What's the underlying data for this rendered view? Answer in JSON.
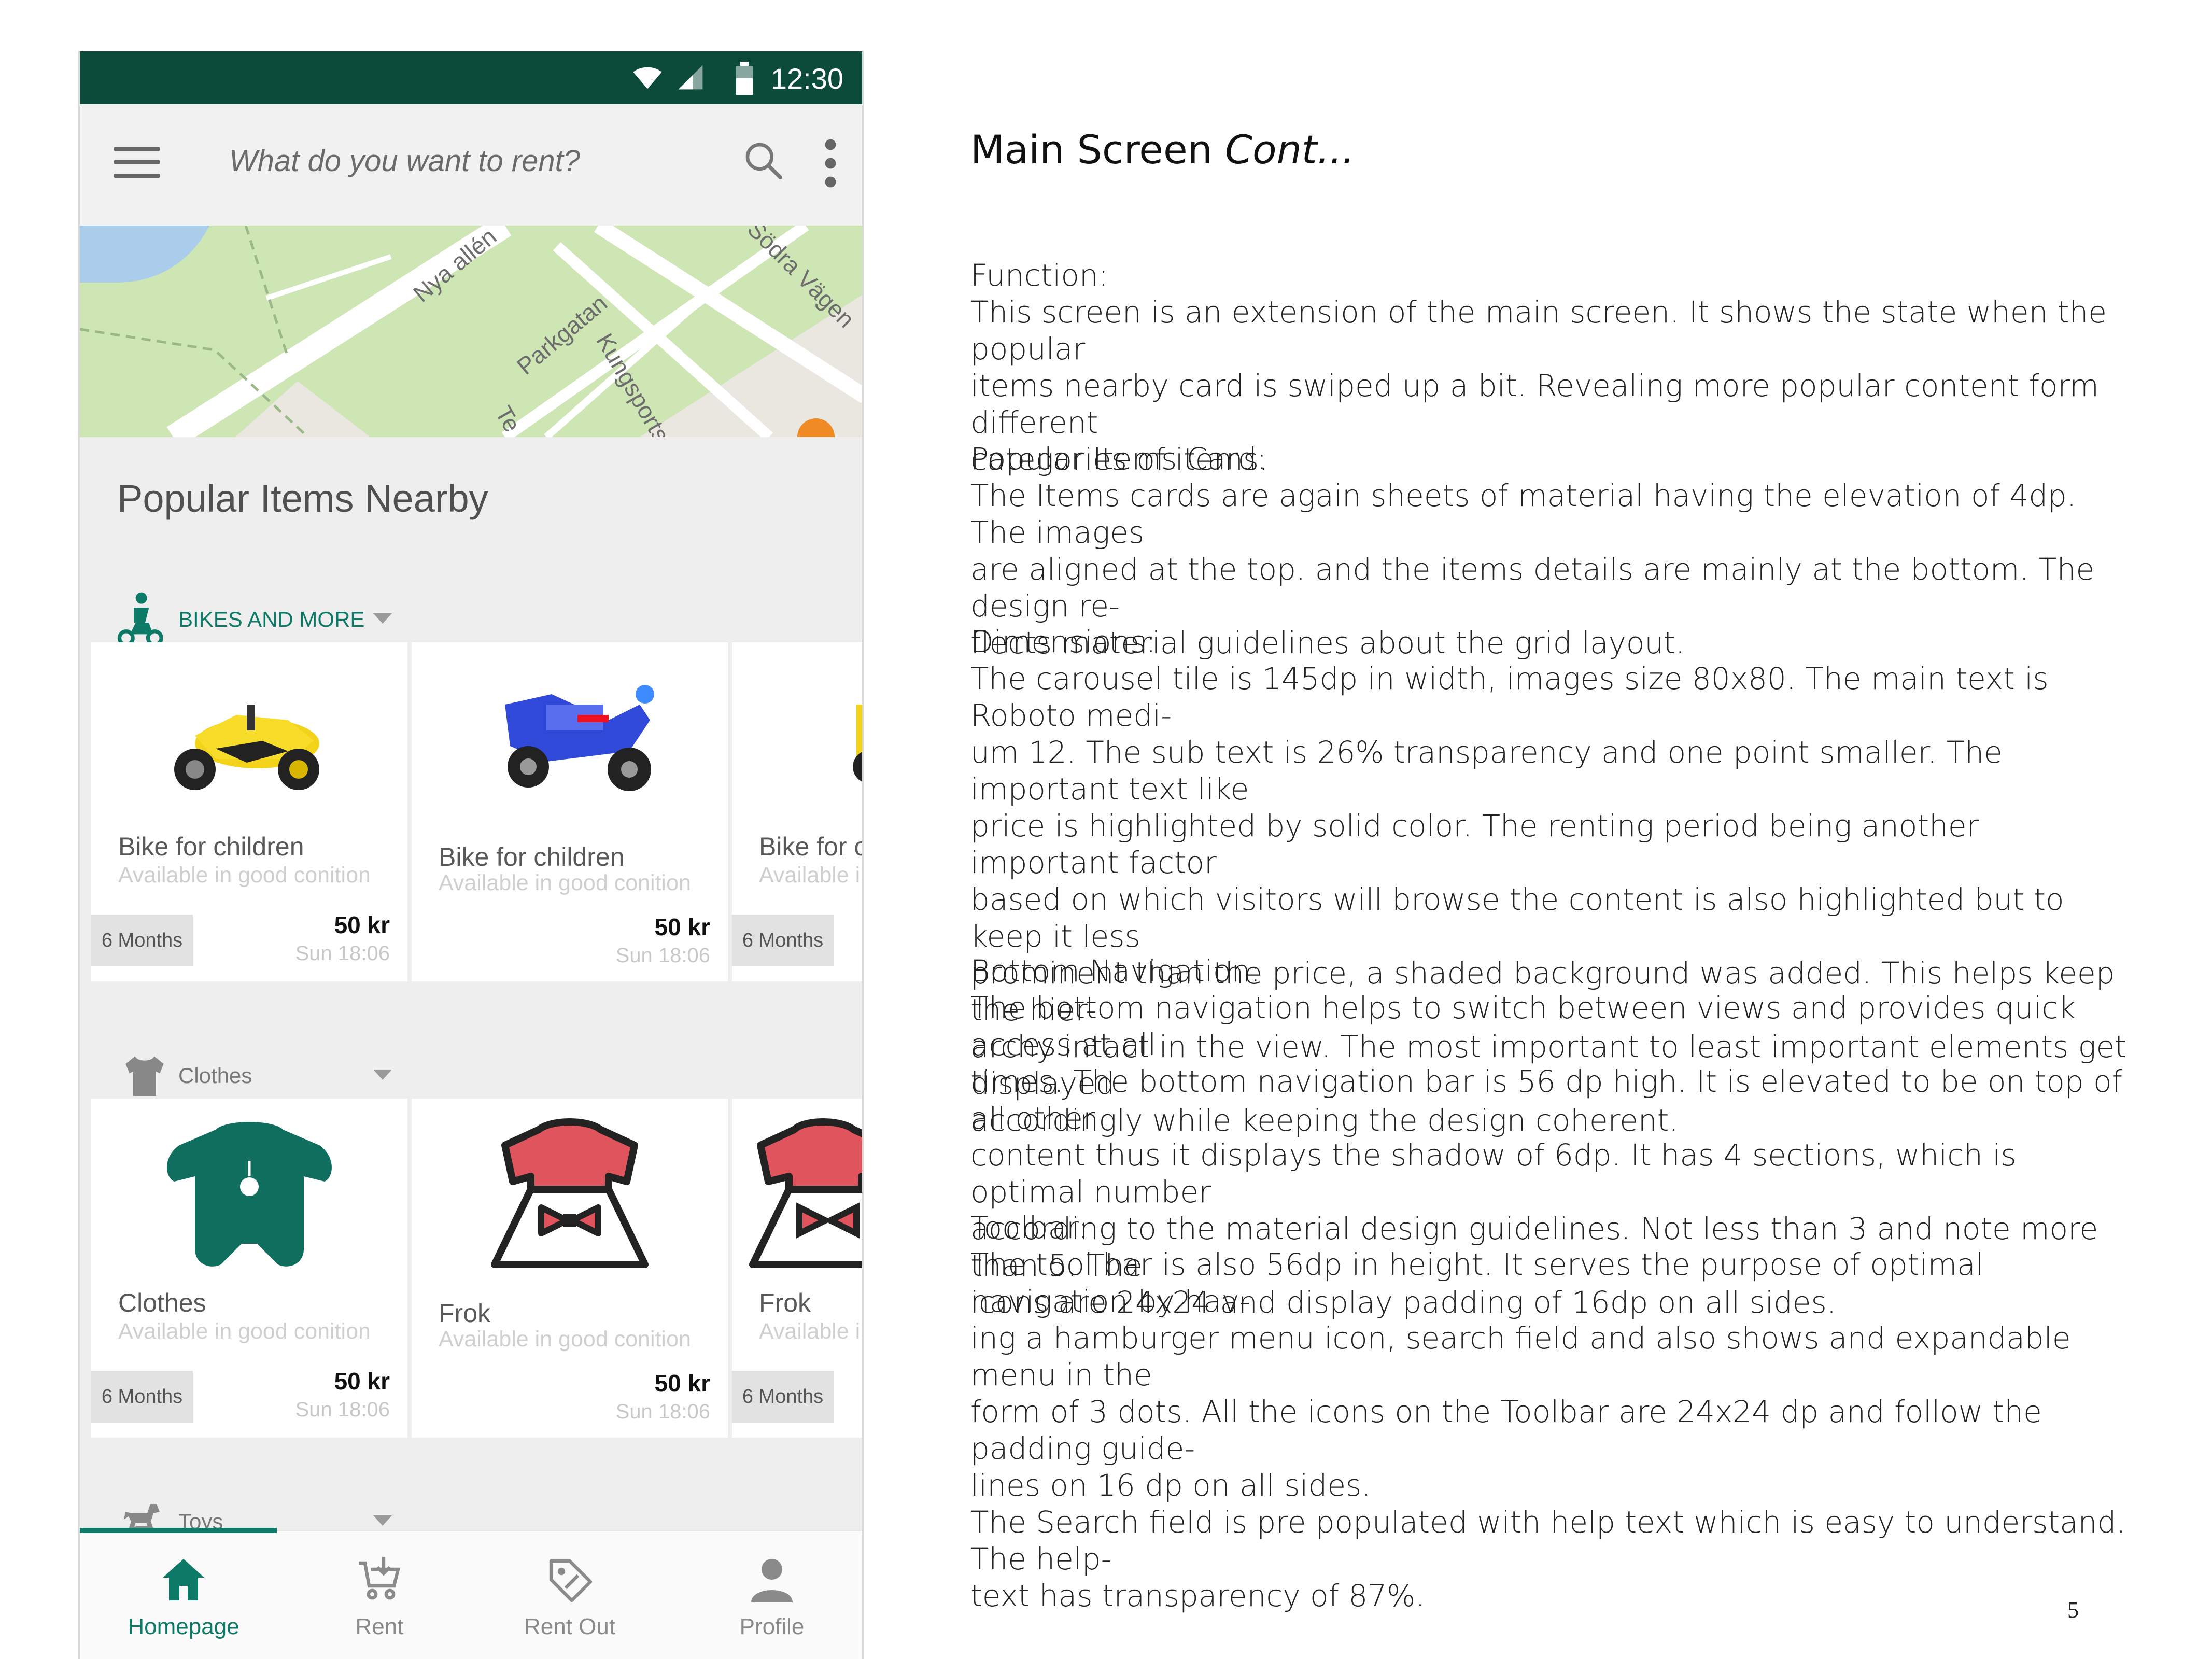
{
  "status_bar": {
    "time": "12:30"
  },
  "toolbar": {
    "search_placeholder": "What do you want to rent?"
  },
  "map": {
    "street_labels": [
      "Nya allén",
      "Parkgatan",
      "Kungsportsavenyn",
      "Södra Vägen",
      "Te"
    ]
  },
  "popular": {
    "title": "Popular Items Nearby",
    "categories": [
      {
        "label": "BIKES AND MORE",
        "icon": "bike-icon",
        "items": [
          {
            "title": "Bike for children",
            "subtitle": "Available in good conition",
            "period": "6 Months",
            "price": "50 kr",
            "date": "Sun 18:06",
            "image": "yellow-toy-bike"
          },
          {
            "title": "Bike for children",
            "subtitle": "Available in good conition",
            "period": "",
            "price": "50 kr",
            "date": "Sun 18:06",
            "image": "blue-toy-motorbike"
          },
          {
            "title": "Bike for c",
            "subtitle": "Available i",
            "period": "6 Months",
            "price": "",
            "date": "",
            "image": "yellow-toy-bike"
          }
        ]
      },
      {
        "label": "Clothes",
        "icon": "tshirt-icon",
        "items": [
          {
            "title": "Clothes",
            "subtitle": "Available in good conition",
            "period": "6 Months",
            "price": "50 kr",
            "date": "Sun 18:06",
            "image": "green-baby-romper"
          },
          {
            "title": "Frok",
            "subtitle": "Available in good conition",
            "period": "",
            "price": "50 kr",
            "date": "Sun 18:06",
            "image": "red-dress"
          },
          {
            "title": "Frok",
            "subtitle": "Available i",
            "period": "6 Months",
            "price": "",
            "date": "",
            "image": "red-dress"
          }
        ]
      },
      {
        "label": "Toys",
        "icon": "rocking-horse-icon"
      }
    ]
  },
  "bottom_nav": {
    "items": [
      {
        "label": "Homepage",
        "icon": "home-icon",
        "active": true
      },
      {
        "label": "Rent",
        "icon": "cart-icon",
        "active": false
      },
      {
        "label": "Rent Out",
        "icon": "tag-icon",
        "active": false
      },
      {
        "label": "Profile",
        "icon": "person-icon",
        "active": false
      }
    ]
  },
  "colors": {
    "accent": "#0c7a66",
    "status_bar": "#0c4b39",
    "card_bg": "#ffffff",
    "screen_bg": "#eeeeee"
  },
  "description": {
    "title_main": "Main Screen",
    "title_italic": "Cont...",
    "sections": [
      {
        "heading": "Function:",
        "lines": [
          "This screen is an extension of the main screen. It shows the state when the popular",
          "items nearby card is swiped up a bit. Revealing more popular content form different",
          "categories of items."
        ]
      },
      {
        "heading": "Popular Items Card:",
        "lines": [
          "The Items cards are again sheets of material having the elevation of 4dp. The images",
          "are aligned at the top. and the items details are mainly at the bottom. The design re-",
          "flects material guidelines about the grid layout."
        ]
      },
      {
        "heading": "Dimensions:",
        "lines": [
          "The carousel tile is 145dp in width, images size 80x80. The main text is Roboto medi-",
          "um 12. The sub text is 26% transparency and one point smaller. The important text like",
          "price is highlighted by solid color. The renting period being another important factor",
          "based on which visitors will browse the content is also highlighted but to keep it less",
          "prominent than the price, a shaded background was added. This helps keep the hier-",
          "archy intact in the view. The most important to least important elements get displayed",
          "accordingly while keeping the design coherent."
        ]
      },
      {
        "heading": "Bottom Navigation:",
        "lines": [
          "The bottom navigation helps to switch between views and provides quick access at all",
          "times. The bottom navigation bar is 56 dp high. It is elevated to be on top of all other",
          "content thus it displays the shadow of 6dp. It has 4 sections, which is optimal number",
          "according to the material design guidelines. Not less than 3 and note more than 5. The",
          "icons are 24x24 and display padding of 16dp on all sides."
        ]
      },
      {
        "heading": "Toolbar:",
        "lines": [
          "The tool bar is also 56dp in height. It serves the purpose of optimal navigation by hav-",
          "ing a hamburger menu icon, search field and also shows and expandable menu in the",
          "form of 3 dots. All the icons on the Toolbar are 24x24 dp and follow the padding guide-",
          "lines on 16 dp on all sides.",
          "The Search field is pre populated with help text which is easy to understand. The help-",
          "text has transparency of 87%."
        ]
      }
    ]
  },
  "page_number": "5"
}
